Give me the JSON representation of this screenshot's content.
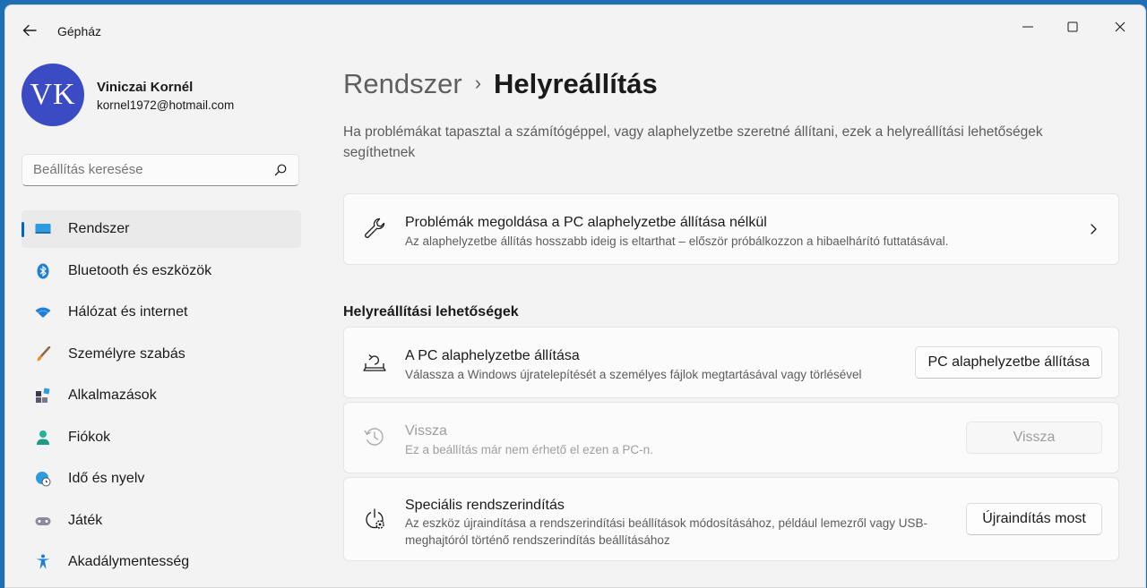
{
  "window": {
    "app_title": "Gépház"
  },
  "user": {
    "initials": "VK",
    "name": "Viniczai Kornél",
    "email": "kornel1972@hotmail.com"
  },
  "search": {
    "placeholder": "Beállítás keresése"
  },
  "sidebar": {
    "items": [
      {
        "label": "Rendszer",
        "icon": "monitor-icon",
        "active": true
      },
      {
        "label": "Bluetooth és eszközök",
        "icon": "bluetooth-icon"
      },
      {
        "label": "Hálózat és internet",
        "icon": "wifi-icon"
      },
      {
        "label": "Személyre szabás",
        "icon": "brush-icon"
      },
      {
        "label": "Alkalmazások",
        "icon": "apps-icon"
      },
      {
        "label": "Fiókok",
        "icon": "person-icon"
      },
      {
        "label": "Idő és nyelv",
        "icon": "globe-clock-icon"
      },
      {
        "label": "Játék",
        "icon": "gamepad-icon"
      },
      {
        "label": "Akadálymentesség",
        "icon": "accessibility-icon"
      }
    ]
  },
  "header": {
    "parent": "Rendszer",
    "separator": "›",
    "current": "Helyreállítás"
  },
  "intro": "Ha problémákat tapasztal a számítógéppel, vagy alaphelyzetbe szeretné állítani, ezek a helyreállítási lehetőségek segíthetnek",
  "troubleshoot": {
    "title": "Problémák megoldása a PC alaphelyzetbe állítása nélkül",
    "desc": "Az alaphelyzetbe állítás hosszabb ideig is eltarthat – először próbálkozzon a hibaelhárító futtatásával.",
    "icon": "wrench-icon"
  },
  "section": {
    "title": "Helyreállítási lehetőségek"
  },
  "options": {
    "reset": {
      "title": "A PC alaphelyzetbe állítása",
      "desc": "Válassza a Windows újratelepítését a személyes fájlok megtartásával vagy törlésével",
      "button": "PC alaphelyzetbe állítása",
      "icon": "reset-pc-icon"
    },
    "goback": {
      "title": "Vissza",
      "desc": "Ez a beállítás már nem érhető el ezen a PC-n.",
      "button": "Vissza",
      "icon": "history-icon",
      "enabled": false
    },
    "advanced": {
      "title": "Speciális rendszerindítás",
      "desc_line1": "Az eszköz újraindítása a rendszerindítási beállítások módosításához, például lemezről vagy USB-",
      "desc_line2": "meghajtóról történő rendszerindítás beállításához",
      "button": "Újraindítás most",
      "icon": "advanced-startup-icon"
    }
  },
  "colors": {
    "accent": "#0067c0",
    "avatar": "#3a4bc4",
    "background": "#f3f3f3"
  }
}
